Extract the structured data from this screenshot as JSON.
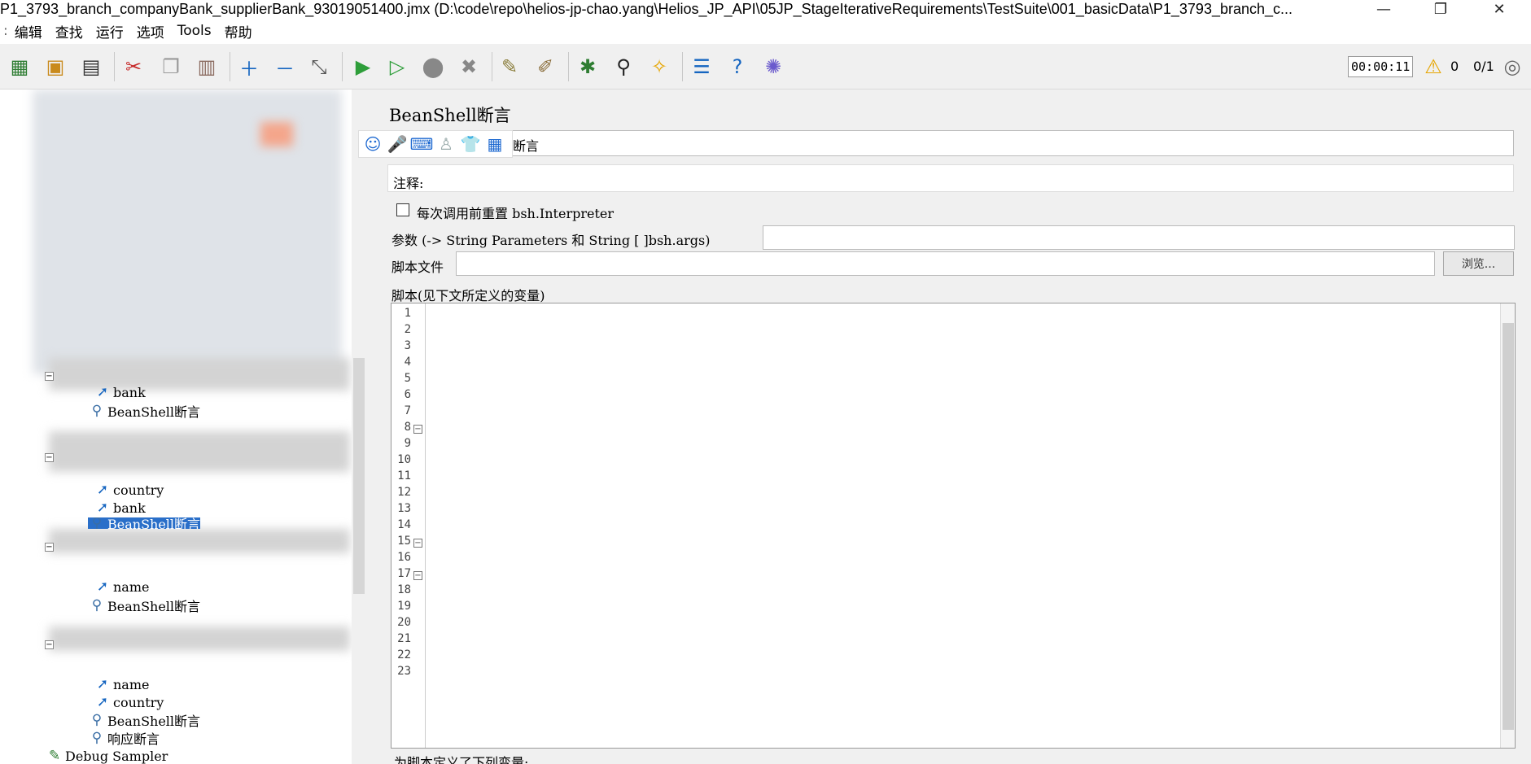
{
  "window": {
    "title": "P1_3793_branch_companyBank_supplierBank_93019051400.jmx (D:\\code\\repo\\helios-jp-chao.yang\\Helios_JP_API\\05JP_StageIterativeRequirements\\TestSuite\\001_basicData\\P1_3793_branch_c...",
    "minimize": "—",
    "restore": "❐",
    "close": "✕"
  },
  "menu": [
    "编辑",
    "查找",
    "运行",
    "选项",
    "Tools",
    "帮助"
  ],
  "toolbar": {
    "timer": "00:00:11",
    "warnings": "0",
    "threads": "0/1"
  },
  "tree": {
    "nodes": [
      {
        "label": "bank",
        "icon": "arrow-icon"
      },
      {
        "label": "BeanShell断言",
        "icon": "magnifier-icon"
      },
      {
        "label": "country",
        "icon": "arrow-icon"
      },
      {
        "label": "bank",
        "icon": "arrow-icon"
      },
      {
        "label": "BeanShell断言",
        "icon": "magnifier-icon"
      },
      {
        "label": "name",
        "icon": "arrow-icon"
      },
      {
        "label": "BeanShell断言",
        "icon": "magnifier-icon"
      },
      {
        "label": "name",
        "icon": "arrow-icon"
      },
      {
        "label": "country",
        "icon": "arrow-icon"
      },
      {
        "label": "BeanShell断言",
        "icon": "magnifier-icon"
      },
      {
        "label": "响应断言",
        "icon": "magnifier-icon"
      },
      {
        "label": "Debug Sampler",
        "icon": "debug-icon"
      }
    ]
  },
  "panel": {
    "title": "BeanShell断言",
    "name_value": "断言",
    "comment_label": "注释:",
    "reset_checkbox_label": "每次调用前重置 bsh.Interpreter",
    "params_label": "参数 (-> String Parameters 和 String [ ]bsh.args)",
    "script_file_label": "脚本文件",
    "browse_button": "浏览...",
    "script_label": "脚本(见下文所定义的变量)",
    "vars_label": "为脚本定义了下列变量:"
  },
  "code": {
    "line_numbers": [
      "1",
      "2",
      "3",
      "4",
      "5",
      "6",
      "7",
      "8",
      "9",
      "10",
      "11",
      "12",
      "13",
      "14",
      "15",
      "16",
      "17",
      "18",
      "19",
      "20",
      "21",
      "22",
      "23"
    ]
  }
}
